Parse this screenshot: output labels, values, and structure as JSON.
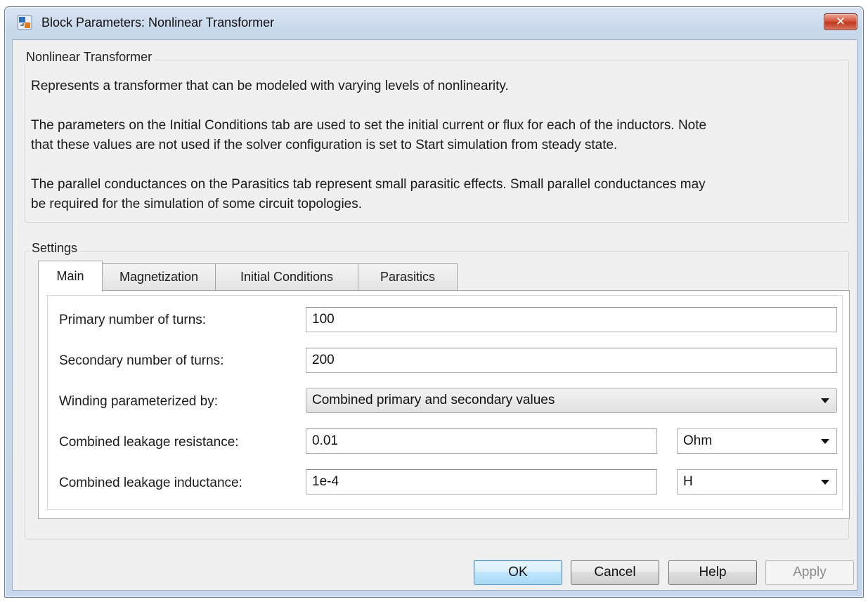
{
  "window": {
    "title": "Block Parameters: Nonlinear Transformer",
    "close_icon": "close-x-icon"
  },
  "description": {
    "group_label": "Nonlinear Transformer",
    "line1": "Represents a transformer that can be modeled with varying levels of nonlinearity.",
    "line2a": "The parameters on the Initial Conditions tab are used to set the initial current or flux for each of the inductors. Note",
    "line2b": "that these values are not used if the solver configuration is set to Start simulation from steady state.",
    "line3a": "The parallel conductances on the Parasitics tab represent small parasitic effects. Small parallel conductances may",
    "line3b": "be required for the simulation of some circuit topologies."
  },
  "settings": {
    "group_label": "Settings",
    "tabs": [
      {
        "label": "Main",
        "active": true
      },
      {
        "label": "Magnetization",
        "active": false
      },
      {
        "label": "Initial Conditions",
        "active": false
      },
      {
        "label": "Parasitics",
        "active": false
      }
    ],
    "fields": {
      "primary_turns": {
        "label": "Primary number of turns:",
        "value": "100"
      },
      "secondary_turns": {
        "label": "Secondary number of turns:",
        "value": "200"
      },
      "winding": {
        "label": "Winding parameterized by:",
        "value": "Combined primary and secondary values"
      },
      "leak_resistance": {
        "label": "Combined leakage resistance:",
        "value": "0.01",
        "unit": "Ohm"
      },
      "leak_inductance": {
        "label": "Combined leakage inductance:",
        "value": "1e-4",
        "unit": "H"
      }
    }
  },
  "buttons": {
    "ok": "OK",
    "cancel": "Cancel",
    "help": "Help",
    "apply": "Apply"
  }
}
